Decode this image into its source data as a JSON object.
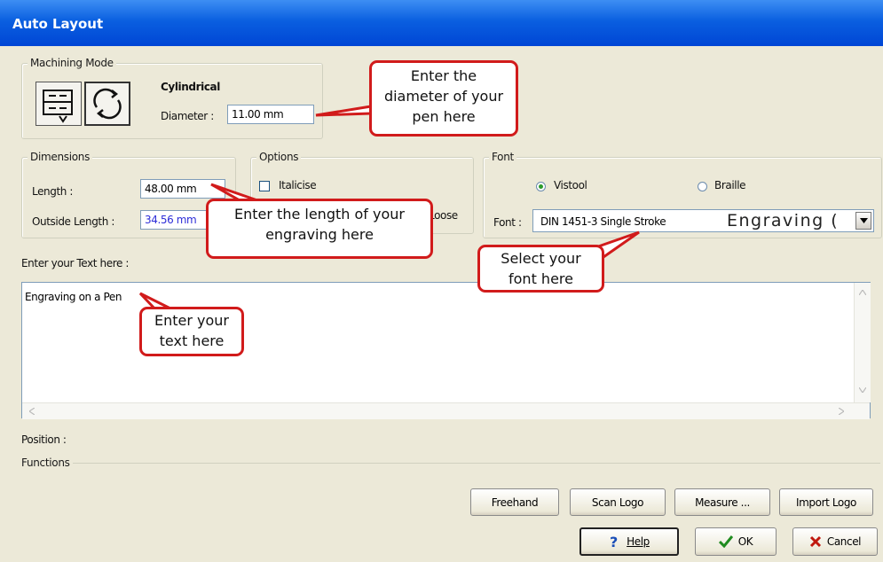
{
  "window": {
    "title": "Auto Layout"
  },
  "machining_mode": {
    "group_label": "Machining Mode",
    "mode_label": "Cylindrical",
    "diameter_label": "Diameter :",
    "diameter_value": "11.00 mm",
    "icons": [
      "flat-mode-icon",
      "cylindrical-rotate-icon"
    ]
  },
  "dimensions": {
    "group_label": "Dimensions",
    "length_label": "Length :",
    "length_value": "48.00 mm",
    "outside_length_label": "Outside Length :",
    "outside_length_value": "34.56 mm"
  },
  "options": {
    "group_label": "Options",
    "italicise_label": "Italicise",
    "italicise_checked": false,
    "partial_label": "Loose"
  },
  "font": {
    "group_label": "Font",
    "radio_vistool": "Vistool",
    "radio_braille": "Braille",
    "selected_radio": "Vistool",
    "font_label": "Font :",
    "font_name": "DIN 1451-3 Single Stroke",
    "font_preview": "Engraving (",
    "dropdown_icon": "chevron-down-icon"
  },
  "text_entry": {
    "label": "Enter your Text here :",
    "value": "Engraving on a Pen"
  },
  "position_label": "Position :",
  "functions": {
    "label": "Functions",
    "buttons": [
      "Freehand",
      "Scan Logo",
      "Measure ...",
      "Import Logo"
    ]
  },
  "footer": {
    "help_label": "Help",
    "ok_label": "OK",
    "cancel_label": "Cancel"
  },
  "callouts": {
    "diameter": "Enter the diameter of your pen here",
    "length": "Enter the length of your engraving here",
    "font": "Select your font here",
    "text": "Enter your text here"
  },
  "colors": {
    "titlebar": "#0a5fe0",
    "callout_border": "#d11b1b",
    "ok_check": "#1f8b1f",
    "cancel_x": "#c0180e",
    "help_icon": "#1b4fb8"
  }
}
